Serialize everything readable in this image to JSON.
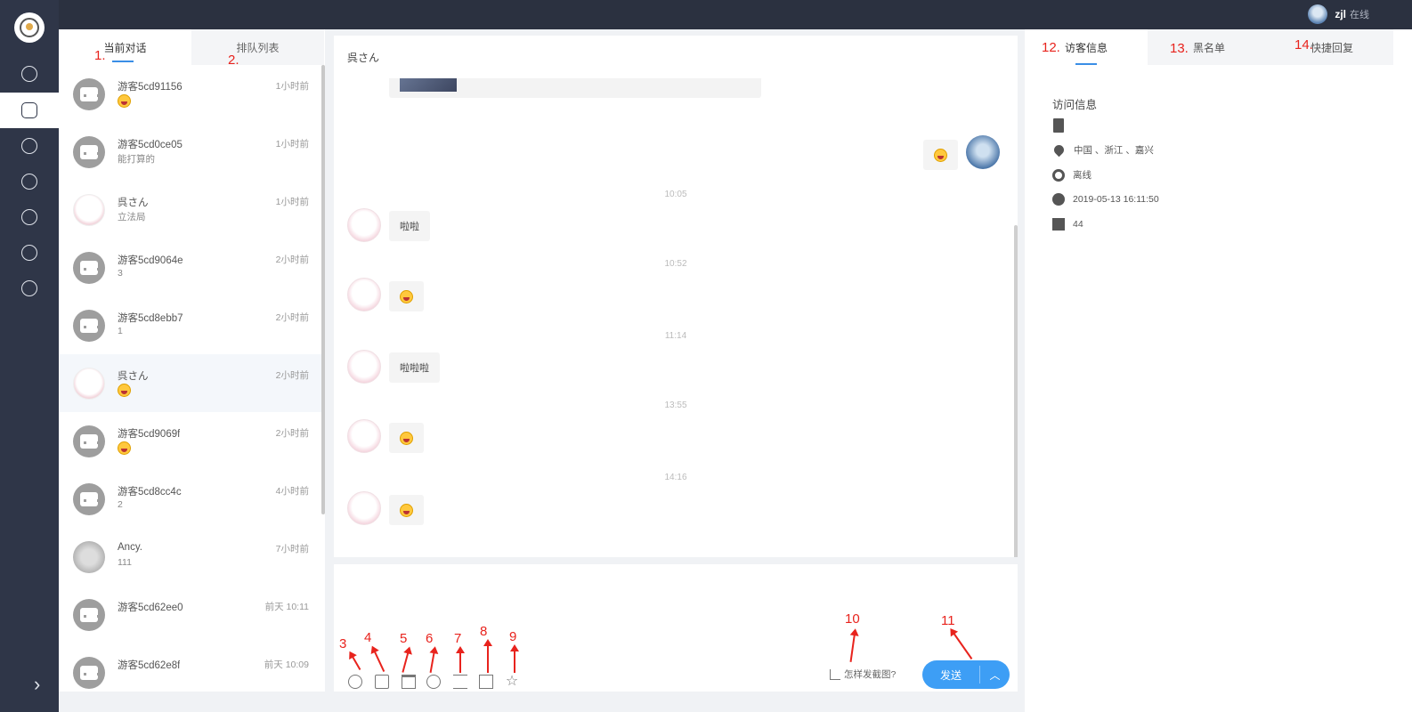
{
  "topbar": {
    "user_name": "zjl",
    "user_status": "在线"
  },
  "nav": {
    "items": [
      "home",
      "chat",
      "history",
      "favorite",
      "users",
      "shop",
      "settings"
    ]
  },
  "list": {
    "tabs": [
      "当前对话",
      "排队列表"
    ],
    "conversations": [
      {
        "name": "游客5cd91156",
        "time": "1小时前",
        "preview": "",
        "avatar": "guest",
        "emoji": true
      },
      {
        "name": "游客5cd0ce05",
        "time": "1小时前",
        "preview": "能打算的",
        "avatar": "guest",
        "emoji": false
      },
      {
        "name": "呉さん",
        "time": "1小时前",
        "preview": "立法局",
        "avatar": "cute",
        "emoji": false
      },
      {
        "name": "游客5cd9064e",
        "time": "2小时前",
        "preview": "3",
        "avatar": "guest",
        "emoji": false
      },
      {
        "name": "游客5cd8ebb7",
        "time": "2小时前",
        "preview": "1",
        "avatar": "guest",
        "emoji": false
      },
      {
        "name": "呉さん",
        "time": "2小时前",
        "preview": "",
        "avatar": "cute",
        "emoji": true
      },
      {
        "name": "游客5cd9069f",
        "time": "2小时前",
        "preview": "",
        "avatar": "guest",
        "emoji": true
      },
      {
        "name": "游客5cd8cc4c",
        "time": "4小时前",
        "preview": "2",
        "avatar": "guest",
        "emoji": false
      },
      {
        "name": "Ancy.",
        "time": "7小时前",
        "preview": "111",
        "avatar": "photo",
        "emoji": false
      },
      {
        "name": "游客5cd62ee0",
        "time": "前天 10:11",
        "preview": "",
        "avatar": "guest",
        "emoji": false
      },
      {
        "name": "游客5cd62e8f",
        "time": "前天 10:09",
        "preview": "",
        "avatar": "guest",
        "emoji": false
      }
    ]
  },
  "chat": {
    "title": "呉さん",
    "messages": [
      {
        "time": "10:05",
        "text": "啦啦"
      },
      {
        "time": "10:52",
        "text": ""
      },
      {
        "time": "11:14",
        "text": "啦啦啦"
      },
      {
        "time": "13:55",
        "text": ""
      },
      {
        "time": "14:16",
        "text": ""
      }
    ],
    "screenshot_hint": "怎样发截图?",
    "send_label": "发送",
    "send_caret": "︿"
  },
  "info": {
    "tabs": [
      "访客信息",
      "黑名单",
      "快捷回复"
    ],
    "section_title": "访问信息",
    "location": "中国 、浙江 、嘉兴",
    "status": "离线",
    "datetime": "2019-05-13 16:11:50",
    "count": "44"
  },
  "annotations": {
    "labels": [
      "1.",
      "2.",
      "3",
      "4",
      "5",
      "6",
      "7",
      "8",
      "9",
      "10",
      "11",
      "12.",
      "13.",
      "14."
    ]
  },
  "colors": {
    "accent": "#3d9ef5",
    "annotation": "#e8231d",
    "nav_bg": "#2f3648"
  }
}
